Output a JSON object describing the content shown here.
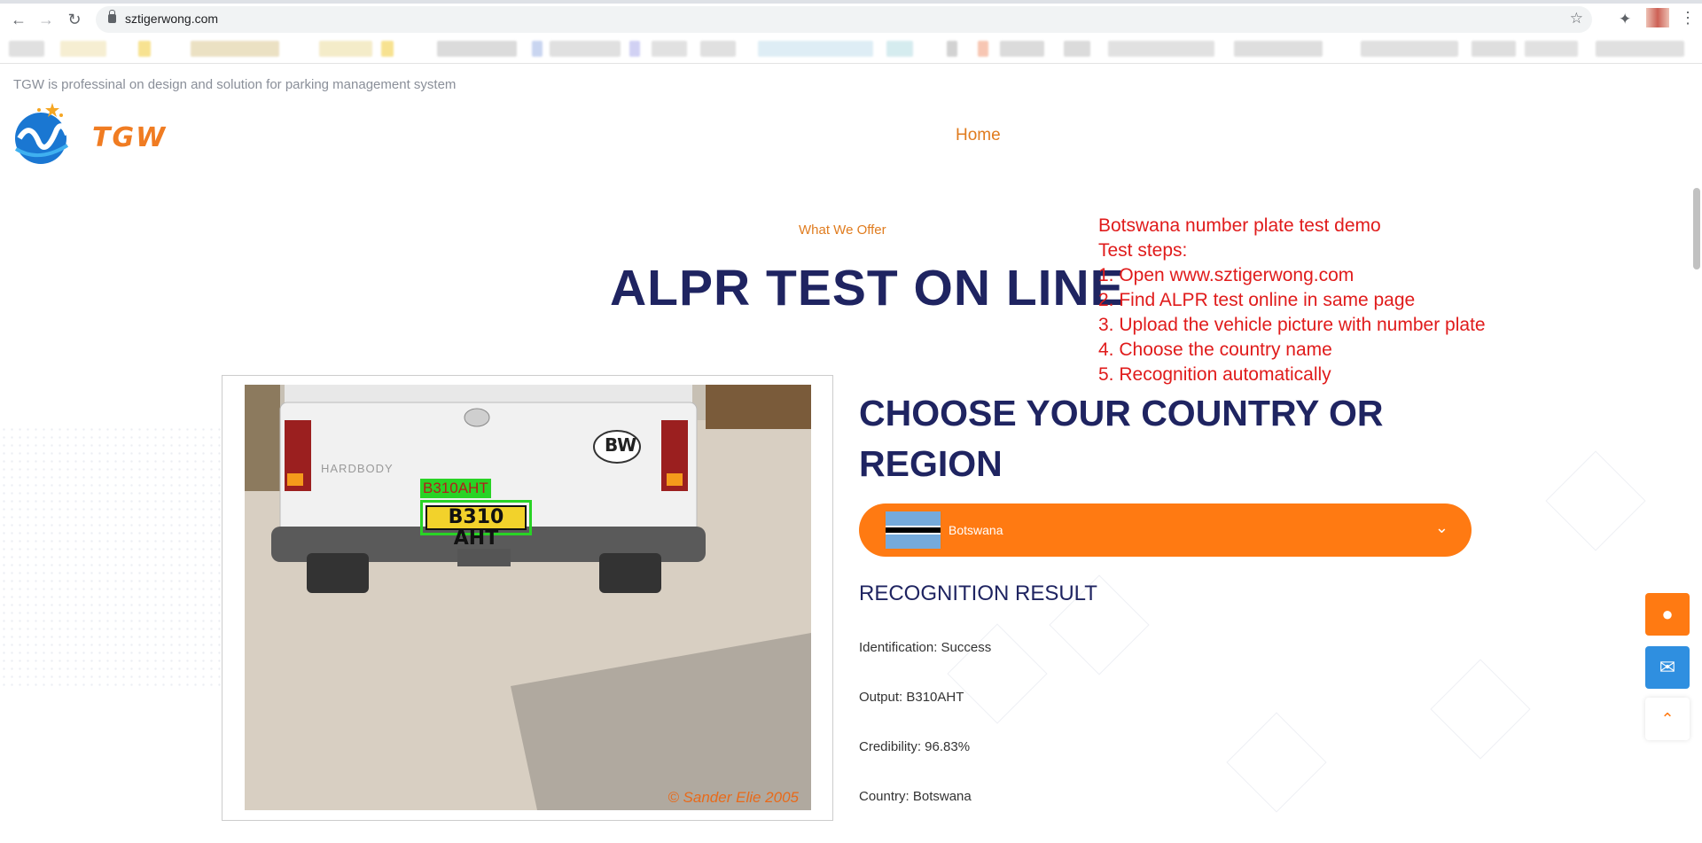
{
  "browser": {
    "url": "sztigerwong.com"
  },
  "site": {
    "tagline": "TGW is professinal on design and solution for parking management system",
    "logo_text": "TGW",
    "nav_home": "Home"
  },
  "section": {
    "eyebrow": "What We Offer",
    "title": "ALPR TEST ON LINE"
  },
  "demo_notes": [
    "Botswana number plate test demo",
    "Test steps:",
    "1. Open www.sztigerwong.com",
    "2. Find ALPR test online in same page",
    "3. Upload the vehicle picture with number plate",
    "4. Choose the country name",
    "5. Recognition automatically"
  ],
  "photo": {
    "detected_label": "B310AHT",
    "plate_text": "B310 AHT",
    "badge_text": "BW",
    "body_text": "HARDBODY",
    "copyright": "© Sander Elie 2005"
  },
  "country": {
    "heading": "CHOOSE YOUR COUNTRY OR REGION",
    "selected": "Botswana"
  },
  "result": {
    "title": "RECOGNITION RESULT",
    "identification": "Identification: Success",
    "output": "Output: B310AHT",
    "credibility": "Credibility: 96.83%",
    "country": "Country: Botswana"
  },
  "colors": {
    "accent_orange": "#ff7a12",
    "title_navy": "#1f2461",
    "note_red": "#e01b1b",
    "detect_green": "#29d325"
  }
}
